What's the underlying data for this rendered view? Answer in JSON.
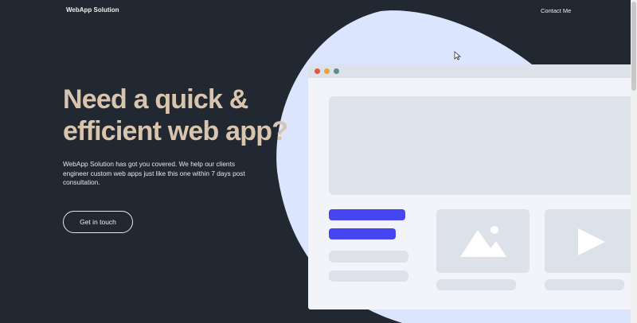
{
  "nav": {
    "brand": "WebApp Solution",
    "contact_link": "Contact Me"
  },
  "hero": {
    "title": "Need a quick & efficient web app?",
    "description": "WebApp Solution has got you covered. We help our clients engineer custom web apps just like this one within 7 days post consultation.",
    "cta_label": "Get in touch"
  },
  "colors": {
    "background": "#222831",
    "title": "#d9c5ad",
    "blob": "#dbe6fe",
    "accent_button": "#4545f2",
    "mock_window": "#f2f4f9",
    "mock_element": "#dde1ea"
  },
  "icons": {
    "mock_window_controls": [
      "close-dot",
      "minimize-dot",
      "maximize-dot"
    ],
    "image_placeholder": "image-icon",
    "video_placeholder": "play-icon",
    "cursor": "mouse-pointer-icon"
  }
}
